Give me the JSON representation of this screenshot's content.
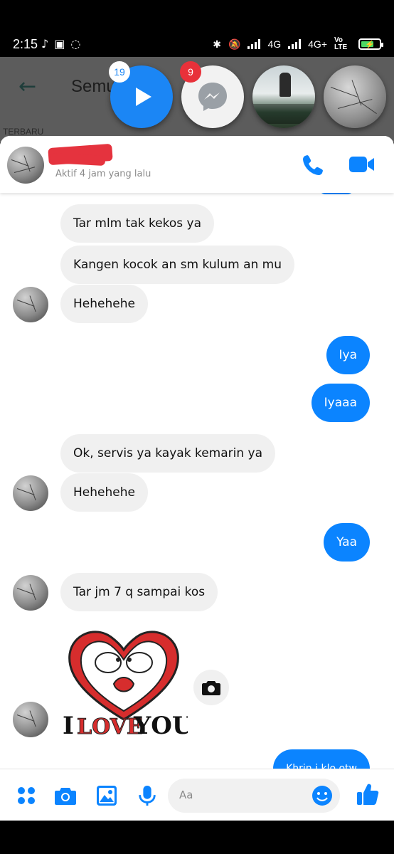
{
  "status_bar": {
    "time": "2:15",
    "network_1": "4G",
    "network_2": "4G+",
    "volte": "Vo LTE",
    "left_icons": [
      "tiktok-icon",
      "bbm-icon",
      "messenger-icon"
    ],
    "right_icons": [
      "bluetooth-icon",
      "mute-icon",
      "signal-icon",
      "battery-charging-icon"
    ]
  },
  "background_app": {
    "title": "Semu",
    "section_label": "TERBARU"
  },
  "chat_heads": [
    {
      "name": "video-chat-head",
      "badge": "19"
    },
    {
      "name": "messenger-chat-head",
      "badge": "9"
    },
    {
      "name": "photo-chat-head",
      "badge": ""
    },
    {
      "name": "contact-chat-head",
      "badge": ""
    }
  ],
  "chat_header": {
    "status": "Aktif 4 jam yang lalu"
  },
  "messages": [
    {
      "dir": "in",
      "text": "Tar mlm tak kekos ya"
    },
    {
      "dir": "in",
      "text": "Kangen kocok an sm kulum an mu"
    },
    {
      "dir": "in",
      "text": "Hehehehe"
    },
    {
      "dir": "out",
      "text": "Iya"
    },
    {
      "dir": "out",
      "text": "Iyaaa"
    },
    {
      "dir": "in",
      "text": "Ok, servis ya kayak kemarin ya"
    },
    {
      "dir": "in",
      "text": "Hehehehe"
    },
    {
      "dir": "out",
      "text": "Yaa"
    },
    {
      "dir": "in",
      "text": "Tar jm 7 q sampai kos"
    },
    {
      "dir": "out",
      "text": "Khrin i klo otw"
    }
  ],
  "sticker": {
    "text_i": "I",
    "text_love": "LOVE",
    "text_you": "YOU"
  },
  "composer": {
    "placeholder": "Aa"
  },
  "colors": {
    "accent": "#0b84ff",
    "incoming_bubble": "#f0f0f0",
    "badge_red": "#e8313a",
    "redaction": "#e5333e"
  }
}
